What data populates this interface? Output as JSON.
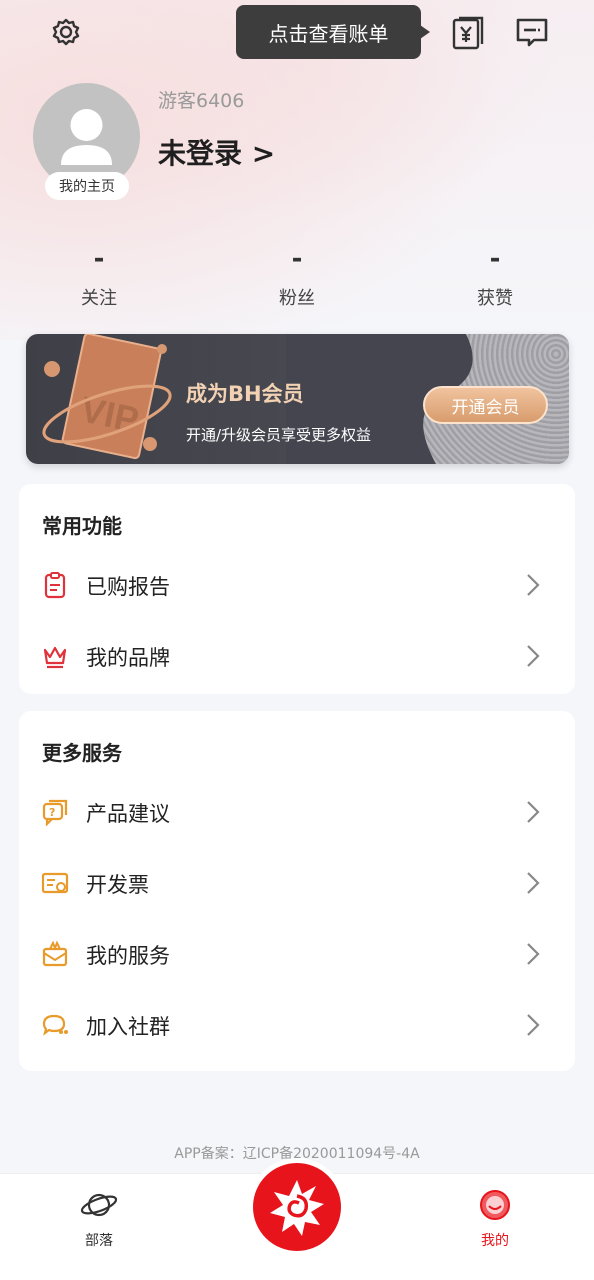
{
  "tooltip": {
    "text": "点击查看账单"
  },
  "icons": {
    "settings": "settings-gear-icon",
    "bill": "bill-yuan-icon",
    "message": "message-icon",
    "avatar": "default-avatar-icon",
    "vip_badge": "vip-card-icon",
    "tab_tribe": "planet-icon",
    "tab_center": "brand-logo-icon",
    "tab_mine": "smile-face-icon"
  },
  "profile": {
    "guest_name": "游客6406",
    "login_text": "未登录 >",
    "homepage_label": "我的主页"
  },
  "stats": [
    {
      "value": "-",
      "label": "关注"
    },
    {
      "value": "-",
      "label": "粉丝"
    },
    {
      "value": "-",
      "label": "获赞"
    }
  ],
  "vip": {
    "title": "成为BH会员",
    "subtitle": "开通/升级会员享受更多权益",
    "button": "开通会员"
  },
  "common": {
    "title": "常用功能",
    "items": [
      {
        "label": "已购报告",
        "icon": "report-clipboard-icon"
      },
      {
        "label": "我的品牌",
        "icon": "crown-icon"
      }
    ]
  },
  "more": {
    "title": "更多服务",
    "items": [
      {
        "label": "产品建议",
        "icon": "question-chat-icon"
      },
      {
        "label": "开发票",
        "icon": "invoice-icon"
      },
      {
        "label": "我的服务",
        "icon": "service-gift-icon"
      },
      {
        "label": "加入社群",
        "icon": "community-chat-icon"
      }
    ]
  },
  "footer": {
    "icp": "APP备案：辽ICP备2020011094号-4A"
  },
  "tabs": [
    {
      "label": "部落"
    },
    {
      "label": "我的"
    }
  ],
  "colors": {
    "accent_red": "#e8141b",
    "icon_orange": "#e89a2a",
    "vip_gold": "#f3d2b4"
  }
}
